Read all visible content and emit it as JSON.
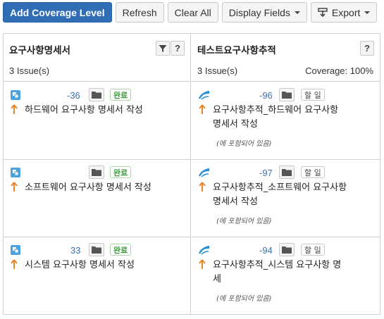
{
  "toolbar": {
    "add_coverage": "Add Coverage Level",
    "refresh": "Refresh",
    "clear_all": "Clear All",
    "display_fields": "Display Fields",
    "export": "Export"
  },
  "left_column": {
    "title": "요구사항명세서",
    "count": "3 Issue(s)",
    "cards": [
      {
        "issue_no": "-36",
        "status": "완료",
        "summary_l1": "하드웨어 요구사항 명세서 작성"
      },
      {
        "issue_no": "",
        "status": "완료",
        "summary_l1": "소프트웨어 요구사항 명세서 작성"
      },
      {
        "issue_no": "33",
        "status": "완료",
        "summary_l1": "시스템 요구사항 명세서 작성"
      }
    ]
  },
  "right_column": {
    "title": "테스트요구사항추적",
    "count": "3 Issue(s)",
    "coverage": "Coverage: 100%",
    "cards": [
      {
        "issue_no": "-96",
        "status": "할 일",
        "summary_l1": "요구사항추적_하드웨어 요구사항",
        "summary_l2": "명세서 작성",
        "note": "(에 포함되어 있음)"
      },
      {
        "issue_no": "-97",
        "status": "할 일",
        "summary_l1": "요구사항추적_소프트웨어 요구사항",
        "summary_l2": "명세서 작성",
        "note": "(에 포함되어 있음)"
      },
      {
        "issue_no": "-94",
        "status": "할 일",
        "summary_l1": "요구사항추적_시스템 요구사항 명",
        "summary_l2": "세",
        "note": "(에 포함되어 있음)"
      }
    ]
  },
  "icons": {
    "story": "story-icon",
    "subtask": "subtask-icon",
    "priority": "arrow-up-icon",
    "folder": "folder-icon",
    "filter": "filter-icon",
    "help": "help-icon"
  },
  "colors": {
    "primary": "#2f6eb5",
    "link": "#3f6fb0",
    "priority": "#e8862a",
    "done": "#3d9a3d"
  }
}
